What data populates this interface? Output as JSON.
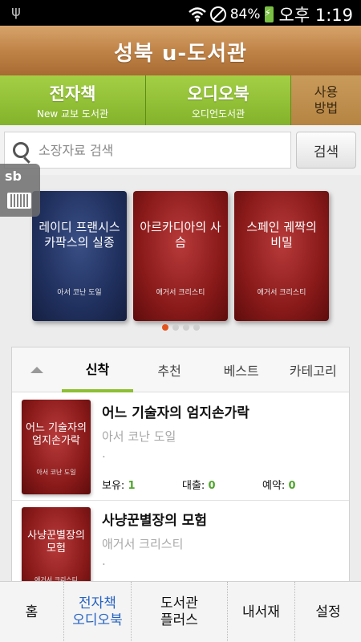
{
  "status_bar": {
    "battery": "84%",
    "time": "오후 1:19"
  },
  "header": {
    "title": "성북 u-도서관"
  },
  "top_tabs": [
    {
      "label": "전자책",
      "sub": "New 교보 도서관"
    },
    {
      "label": "오디오북",
      "sub": "오디언도서관"
    }
  ],
  "usage_button": {
    "line1": "사용",
    "line2": "방법"
  },
  "search": {
    "placeholder": "소장자료 검색",
    "button_label": "검색"
  },
  "side_widget": {
    "label": "sb"
  },
  "carousel": {
    "books": [
      {
        "title": "레이디 프랜시스 카팍스의 실종",
        "author": "아서 코난 도일",
        "cover": "blue"
      },
      {
        "title": "아르카디아의 사슴",
        "author": "애거서 크리스티",
        "cover": "red"
      },
      {
        "title": "스페인 궤짝의 비밀",
        "author": "애거서 크리스티",
        "cover": "red"
      }
    ],
    "page_count": 4,
    "active_page": 1
  },
  "list_tabs": [
    {
      "label": "신착"
    },
    {
      "label": "추천"
    },
    {
      "label": "베스트"
    },
    {
      "label": "카테고리"
    }
  ],
  "list_items": [
    {
      "title": "어느 기술자의 엄지손가락",
      "author": "아서 코난 도일",
      "extra": ".",
      "owned_label": "보유:",
      "owned": "1",
      "loan_label": "대출:",
      "loan": "0",
      "reserve_label": "예약:",
      "reserve": "0"
    },
    {
      "title": "사냥꾼별장의 모험",
      "author": "애거서 크리스티",
      "extra": "."
    }
  ],
  "bottom_nav": {
    "home": "홈",
    "ebook_line1": "전자책",
    "ebook_line2": "오디오북",
    "plus_line1": "도서관",
    "plus_line2": "플러스",
    "mybooks": "내서재",
    "settings": "설정"
  }
}
